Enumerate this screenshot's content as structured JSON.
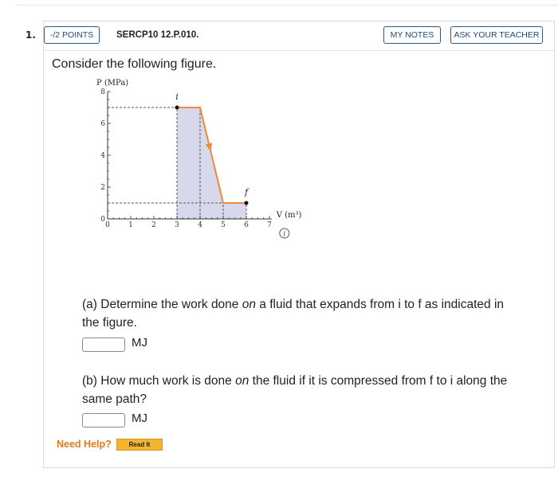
{
  "question": {
    "number": "1.",
    "points": "-/2 POINTS",
    "code": "SERCP10 12.P.010.",
    "my_notes": "MY NOTES",
    "ask_teacher": "ASK YOUR TEACHER",
    "intro": "Consider the following figure.",
    "part_a": {
      "text_pre": "(a) Determine the work done ",
      "text_em": "on",
      "text_post": " a fluid that expands from i to f as indicated in the figure.",
      "answer_value": "",
      "unit": "MJ"
    },
    "part_b": {
      "text_pre": "(b) How much work is done ",
      "text_em": "on",
      "text_post": " the fluid if it is compressed from f to i along the same path?",
      "answer_value": "",
      "unit": "MJ"
    },
    "need_help": "Need Help?",
    "read_it": "Read It"
  },
  "chart_data": {
    "type": "line",
    "ylabel": "P (MPa)",
    "xlabel": "V (m³)",
    "x_ticks": [
      "0",
      "1",
      "2",
      "3",
      "4",
      "5",
      "6",
      "7"
    ],
    "y_ticks": [
      "0",
      "2",
      "4",
      "6",
      "8"
    ],
    "xlim": [
      0,
      7
    ],
    "ylim": [
      0,
      8
    ],
    "path": [
      [
        3,
        7
      ],
      [
        4,
        7
      ],
      [
        5,
        1
      ],
      [
        6,
        1
      ]
    ],
    "points": [
      {
        "label": "i",
        "x": 3,
        "y": 7
      },
      {
        "label": "f",
        "x": 6,
        "y": 1
      }
    ],
    "line_color": "#f0893a",
    "fill_color": "#d8d8ec",
    "info_icon": "info-icon"
  }
}
